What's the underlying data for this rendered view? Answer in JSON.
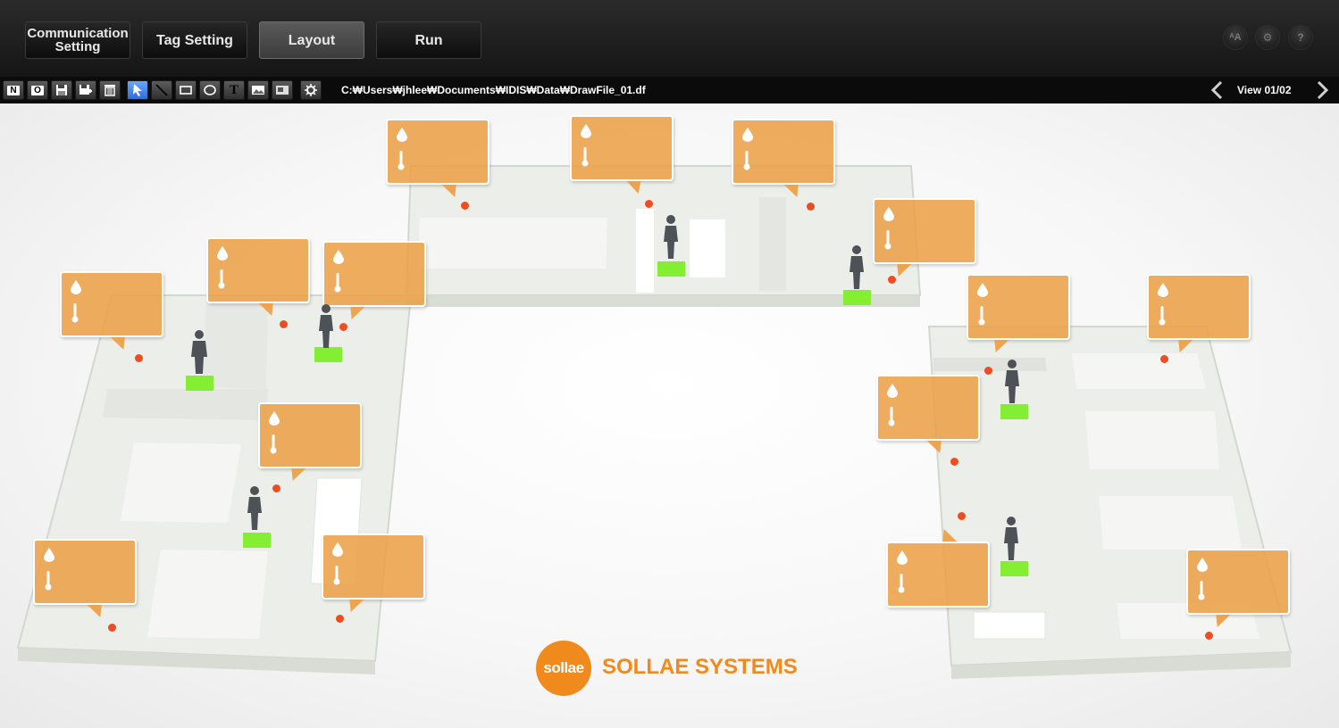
{
  "tabs": [
    {
      "line1": "Communication",
      "line2": "Setting",
      "active": false
    },
    {
      "label": "Tag Setting",
      "active": false
    },
    {
      "label": "Layout",
      "active": true
    },
    {
      "label": "Run",
      "active": false
    }
  ],
  "top_right_buttons": [
    {
      "glyph": "ᴬ",
      "icon": "language-icon"
    },
    {
      "glyph": "⚙",
      "icon": "gear-icon"
    },
    {
      "glyph": "?",
      "icon": "help-icon"
    }
  ],
  "toolbar": {
    "tools": [
      {
        "label": "N",
        "icon": "new-file-icon"
      },
      {
        "label": "O",
        "icon": "open-file-icon"
      },
      {
        "label": "",
        "icon": "save-icon"
      },
      {
        "label": "",
        "icon": "save-as-icon"
      },
      {
        "label": "",
        "icon": "trash-icon"
      },
      {
        "label": "",
        "icon": "pointer-icon",
        "active": true
      },
      {
        "label": "",
        "icon": "line-tool-icon"
      },
      {
        "label": "",
        "icon": "rectangle-tool-icon"
      },
      {
        "label": "",
        "icon": "ellipse-tool-icon"
      },
      {
        "label": "T",
        "icon": "text-tool-icon"
      },
      {
        "label": "",
        "icon": "image-tool-icon"
      },
      {
        "label": "",
        "icon": "picture-tool-icon"
      },
      {
        "label": "",
        "icon": "settings-tool-icon"
      }
    ],
    "file_path": "C:₩Users₩jhlee₩Documents₩IDIS₩Data₩DrawFile_01.df",
    "view_label": "View 01/02"
  },
  "logo": {
    "mark": "sollae",
    "name": "SOLLAE SYSTEMS",
    "color": "#f08a1d"
  },
  "colors": {
    "callout": "#eca048",
    "sensor_dot": "#ee4d22",
    "tag": "#84ee32"
  }
}
